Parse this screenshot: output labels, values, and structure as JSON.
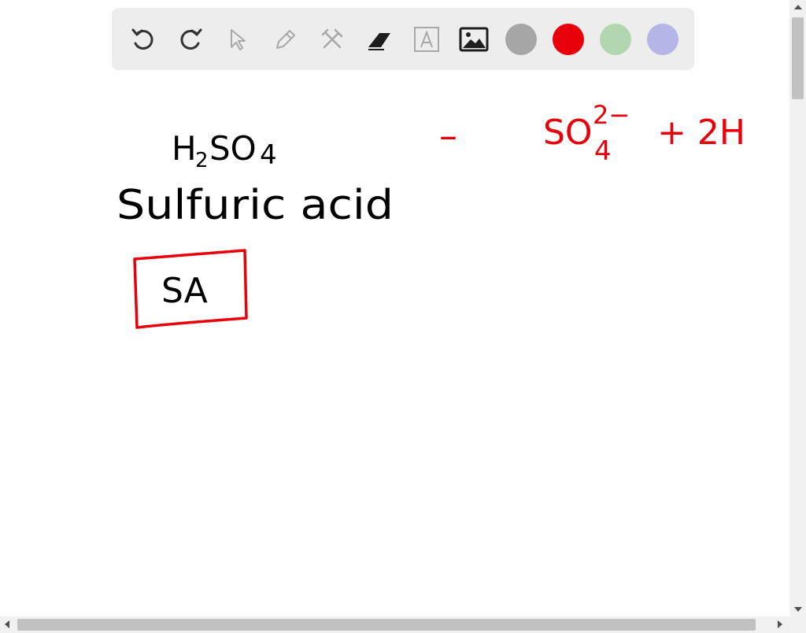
{
  "toolbar": {
    "tools": [
      {
        "id": "undo",
        "icon": "undo-icon"
      },
      {
        "id": "redo",
        "icon": "redo-icon"
      },
      {
        "id": "select",
        "icon": "pointer-icon"
      },
      {
        "id": "pen",
        "icon": "pencil-icon"
      },
      {
        "id": "tools",
        "icon": "tools-icon"
      },
      {
        "id": "eraser",
        "icon": "eraser-icon"
      },
      {
        "id": "text",
        "icon": "text-box-icon"
      },
      {
        "id": "image",
        "icon": "image-icon"
      }
    ],
    "colors": [
      {
        "name": "gray",
        "hex": "#a6a6a6"
      },
      {
        "name": "red",
        "hex": "#e8000b"
      },
      {
        "name": "green",
        "hex": "#b2d7b0"
      },
      {
        "name": "lavender",
        "hex": "#b5b5e8"
      }
    ]
  },
  "notes": {
    "formula": {
      "h": "H",
      "sub2": "2",
      "so": "SO",
      "sub4": "4"
    },
    "name": "Sulfuric acid",
    "box_label": "SA",
    "equation": {
      "dash": "–",
      "so": "SO",
      "charge": "2−",
      "sub4": "4",
      "plus_term": "+ 2H"
    }
  },
  "ink_colors": {
    "black": "#000000",
    "red": "#e8000b"
  }
}
